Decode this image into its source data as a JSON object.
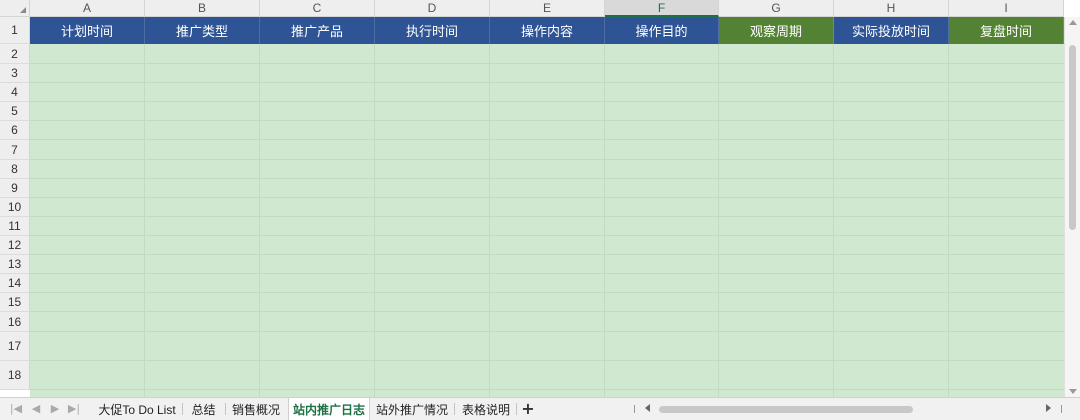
{
  "columns": [
    "A",
    "B",
    "C",
    "D",
    "E",
    "F",
    "G",
    "H",
    "I"
  ],
  "active_column": "F",
  "rows": [
    "1",
    "2",
    "3",
    "4",
    "5",
    "6",
    "7",
    "8",
    "9",
    "10",
    "11",
    "12",
    "13",
    "14",
    "15",
    "16",
    "17",
    "18"
  ],
  "header_row": [
    {
      "text": "计划时间",
      "fill": "#2f5496"
    },
    {
      "text": "推广类型",
      "fill": "#2f5496"
    },
    {
      "text": "推广产品",
      "fill": "#2f5496"
    },
    {
      "text": "执行时间",
      "fill": "#2f5496"
    },
    {
      "text": "操作内容",
      "fill": "#2f5496"
    },
    {
      "text": "操作目的",
      "fill": "#2f5496"
    },
    {
      "text": "观察周期",
      "fill": "#548235"
    },
    {
      "text": "实际投放时间",
      "fill": "#2f5496"
    },
    {
      "text": "复盘时间",
      "fill": "#548235"
    }
  ],
  "cell_fill": "#cfe8cf",
  "sheet_tabs": [
    {
      "label": "大促To Do List",
      "active": false
    },
    {
      "label": "总结",
      "active": false
    },
    {
      "label": "销售概况",
      "active": false
    },
    {
      "label": "站内推广日志",
      "active": true
    },
    {
      "label": "站外推广情况",
      "active": false
    },
    {
      "label": "表格说明",
      "active": false
    }
  ],
  "add_sheet_label": "+",
  "nav_icons": [
    "first-sheet-icon",
    "prev-sheet-icon",
    "next-sheet-icon",
    "last-sheet-icon"
  ]
}
